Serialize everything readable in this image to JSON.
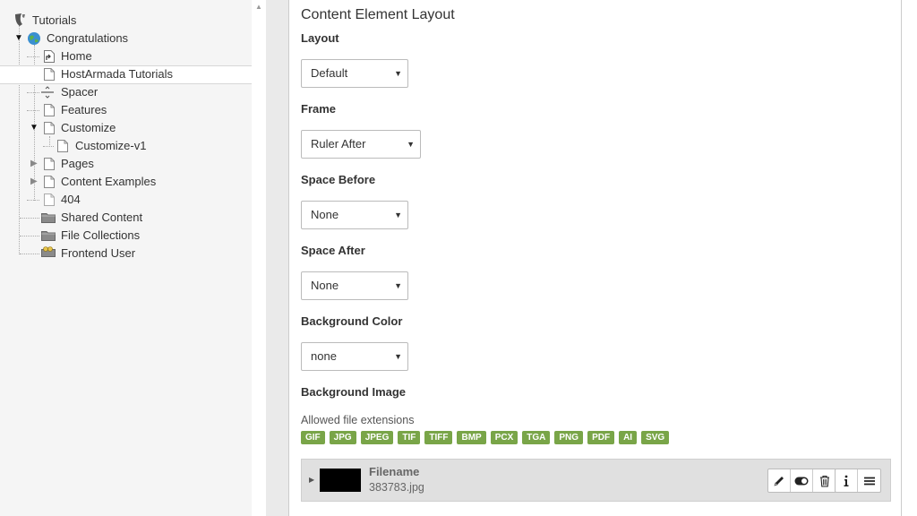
{
  "tree": {
    "root_label": "Tutorials",
    "items": [
      {
        "label": "Congratulations",
        "icon": "globe-icon"
      },
      {
        "label": "Home",
        "icon": "shortcut-page-icon"
      },
      {
        "label": "HostArmada Tutorials",
        "icon": "page-icon"
      },
      {
        "label": "Spacer",
        "icon": "spacer-icon"
      },
      {
        "label": "Features",
        "icon": "page-icon"
      },
      {
        "label": "Customize",
        "icon": "page-icon"
      },
      {
        "label": "Customize-v1",
        "icon": "page-icon"
      },
      {
        "label": "Pages",
        "icon": "page-icon"
      },
      {
        "label": "Content Examples",
        "icon": "page-icon"
      },
      {
        "label": "404",
        "icon": "page-icon"
      },
      {
        "label": "Shared Content",
        "icon": "folder-icon"
      },
      {
        "label": "File Collections",
        "icon": "folder-icon"
      },
      {
        "label": "Frontend User",
        "icon": "user-folder-icon"
      }
    ]
  },
  "form": {
    "section_title": "Content Element Layout",
    "layout_label": "Layout",
    "layout_value": "Default",
    "frame_label": "Frame",
    "frame_value": "Ruler After",
    "space_before_label": "Space Before",
    "space_before_value": "None",
    "space_after_label": "Space After",
    "space_after_value": "None",
    "bg_color_label": "Background Color",
    "bg_color_value": "none",
    "bg_image_label": "Background Image",
    "allowed_label": "Allowed file extensions",
    "extensions": [
      "GIF",
      "JPG",
      "JPEG",
      "TIF",
      "TIFF",
      "BMP",
      "PCX",
      "TGA",
      "PNG",
      "PDF",
      "AI",
      "SVG"
    ]
  },
  "file": {
    "title": "Filename",
    "name": "383783.jpg"
  },
  "colors": {
    "badge_green": "#79a548",
    "tree_background": "#f5f5f5"
  }
}
